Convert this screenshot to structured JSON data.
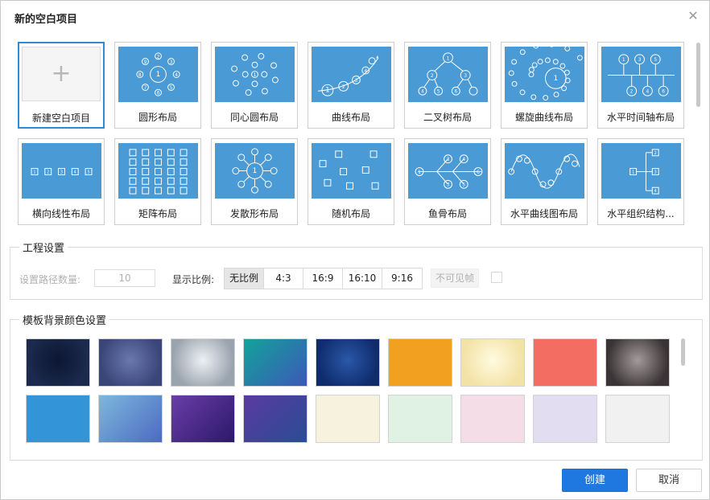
{
  "dialog": {
    "title": "新的空白项目",
    "close_icon": "close-icon"
  },
  "layouts": [
    {
      "label": "新建空白项目",
      "icon": "plus-icon",
      "selected": true
    },
    {
      "label": "圆形布局"
    },
    {
      "label": "同心圆布局"
    },
    {
      "label": "曲线布局"
    },
    {
      "label": "二叉树布局"
    },
    {
      "label": "螺旋曲线布局"
    },
    {
      "label": "水平时间轴布局"
    },
    {
      "label": "横向线性布局"
    },
    {
      "label": "矩阵布局"
    },
    {
      "label": "发散形布局"
    },
    {
      "label": "随机布局"
    },
    {
      "label": "鱼骨布局"
    },
    {
      "label": "水平曲线图布局"
    },
    {
      "label": "水平组织结构..."
    }
  ],
  "project_settings": {
    "title": "工程设置",
    "path_count_label": "设置路径数量:",
    "path_count_value": "10",
    "ratio_label": "显示比例:",
    "ratios": [
      "无比例",
      "4:3",
      "16:9",
      "16:10",
      "9:16"
    ],
    "active_ratio": "无比例",
    "invisible_frame_label": "不可见帧",
    "invisible_frame_checked": false
  },
  "background_settings": {
    "title": "模板背景颜色设置",
    "swatches": [
      {
        "colors": [
          "#0c1630",
          "#1b2a4e"
        ],
        "style": "radial"
      },
      {
        "colors": [
          "#6a78b0",
          "#3a4678"
        ],
        "style": "radial"
      },
      {
        "colors": [
          "#eef1f4",
          "#9aa4ae"
        ],
        "style": "radial"
      },
      {
        "colors": [
          "#12a39a",
          "#3d58b8"
        ],
        "style": "linear"
      },
      {
        "colors": [
          "#2a58a8",
          "#0f2c6c"
        ],
        "style": "radial"
      },
      {
        "colors": [
          "#f2a020",
          "#f2a020"
        ],
        "style": "flat"
      },
      {
        "colors": [
          "#fffbe0",
          "#f3e2a6"
        ],
        "style": "radial"
      },
      {
        "colors": [
          "#f36d62",
          "#f36d62"
        ],
        "style": "flat"
      },
      {
        "colors": [
          "#a39a9a",
          "#3a3436"
        ],
        "style": "radial"
      },
      {
        "colors": [
          "#3494d8",
          "#3494d8"
        ],
        "style": "flat"
      },
      {
        "colors": [
          "#7cb8dc",
          "#4d6ac2"
        ],
        "style": "linear"
      },
      {
        "colors": [
          "#6a3ea8",
          "#2c186a"
        ],
        "style": "linear"
      },
      {
        "colors": [
          "#5a3aa0",
          "#2a4d94"
        ],
        "style": "linear"
      },
      {
        "colors": [
          "#f6f2dd",
          "#f6f2dd"
        ],
        "style": "flat"
      },
      {
        "colors": [
          "#dff2e4",
          "#dff2e4"
        ],
        "style": "flat"
      },
      {
        "colors": [
          "#f5dde8",
          "#f5dde8"
        ],
        "style": "flat"
      },
      {
        "colors": [
          "#e3ddf2",
          "#e3ddf2"
        ],
        "style": "flat"
      },
      {
        "colors": [
          "#f1f1f1",
          "#f1f1f1"
        ],
        "style": "flat"
      }
    ]
  },
  "footer": {
    "create_label": "创建",
    "cancel_label": "取消"
  },
  "theme": {
    "accent": "#1f77e0",
    "thumb_blue": "#4a9ad6"
  }
}
